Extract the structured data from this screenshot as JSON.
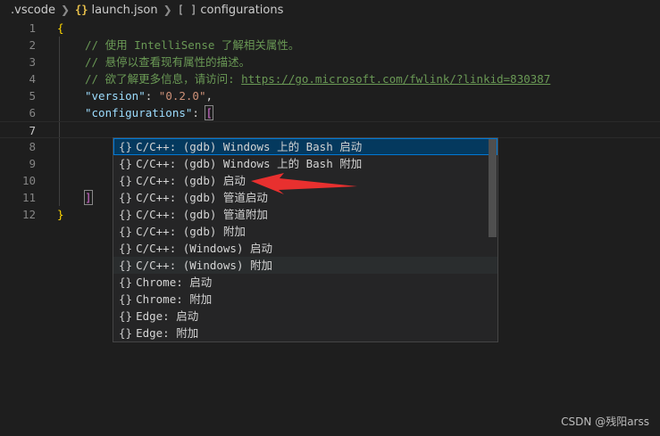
{
  "breadcrumb": {
    "folder": ".vscode",
    "file_icon": "{}",
    "file": "launch.json",
    "node_icon": "[ ]",
    "node": "configurations"
  },
  "editor": {
    "line_numbers": [
      "1",
      "2",
      "3",
      "4",
      "5",
      "6",
      "7",
      "8",
      "9",
      "10",
      "11",
      "12"
    ],
    "line1_brace": "{",
    "line2_comment": "// 使用 IntelliSense 了解相关属性。",
    "line3_comment": "// 悬停以查看现有属性的描述。",
    "line4_comment_prefix": "// 欲了解更多信息，请访问: ",
    "line4_link": "https://go.microsoft.com/fwlink/?linkid=830387",
    "line5_key": "\"version\"",
    "line5_colon": ": ",
    "line5_value": "\"0.2.0\"",
    "line5_comma": ",",
    "line6_key": "\"configurations\"",
    "line6_colon": ": ",
    "line6_bracket": "[",
    "line11_bracket": "]",
    "line12_brace": "}"
  },
  "suggest": {
    "icon": "{}",
    "items": [
      "C/C++: (gdb) Windows 上的 Bash 启动",
      "C/C++: (gdb) Windows 上的 Bash 附加",
      "C/C++: (gdb) 启动",
      "C/C++: (gdb) 管道启动",
      "C/C++: (gdb) 管道附加",
      "C/C++: (gdb) 附加",
      "C/C++: (Windows) 启动",
      "C/C++: (Windows) 附加",
      "Chrome: 启动",
      "Chrome: 附加",
      "Edge: 启动",
      "Edge: 附加"
    ]
  },
  "watermark": "CSDN @残阳arss",
  "colors": {
    "arrow": "#e8302f",
    "selected_bg": "#04395e",
    "comment": "#6a9955",
    "string": "#ce9178",
    "key": "#9cdcfe"
  }
}
